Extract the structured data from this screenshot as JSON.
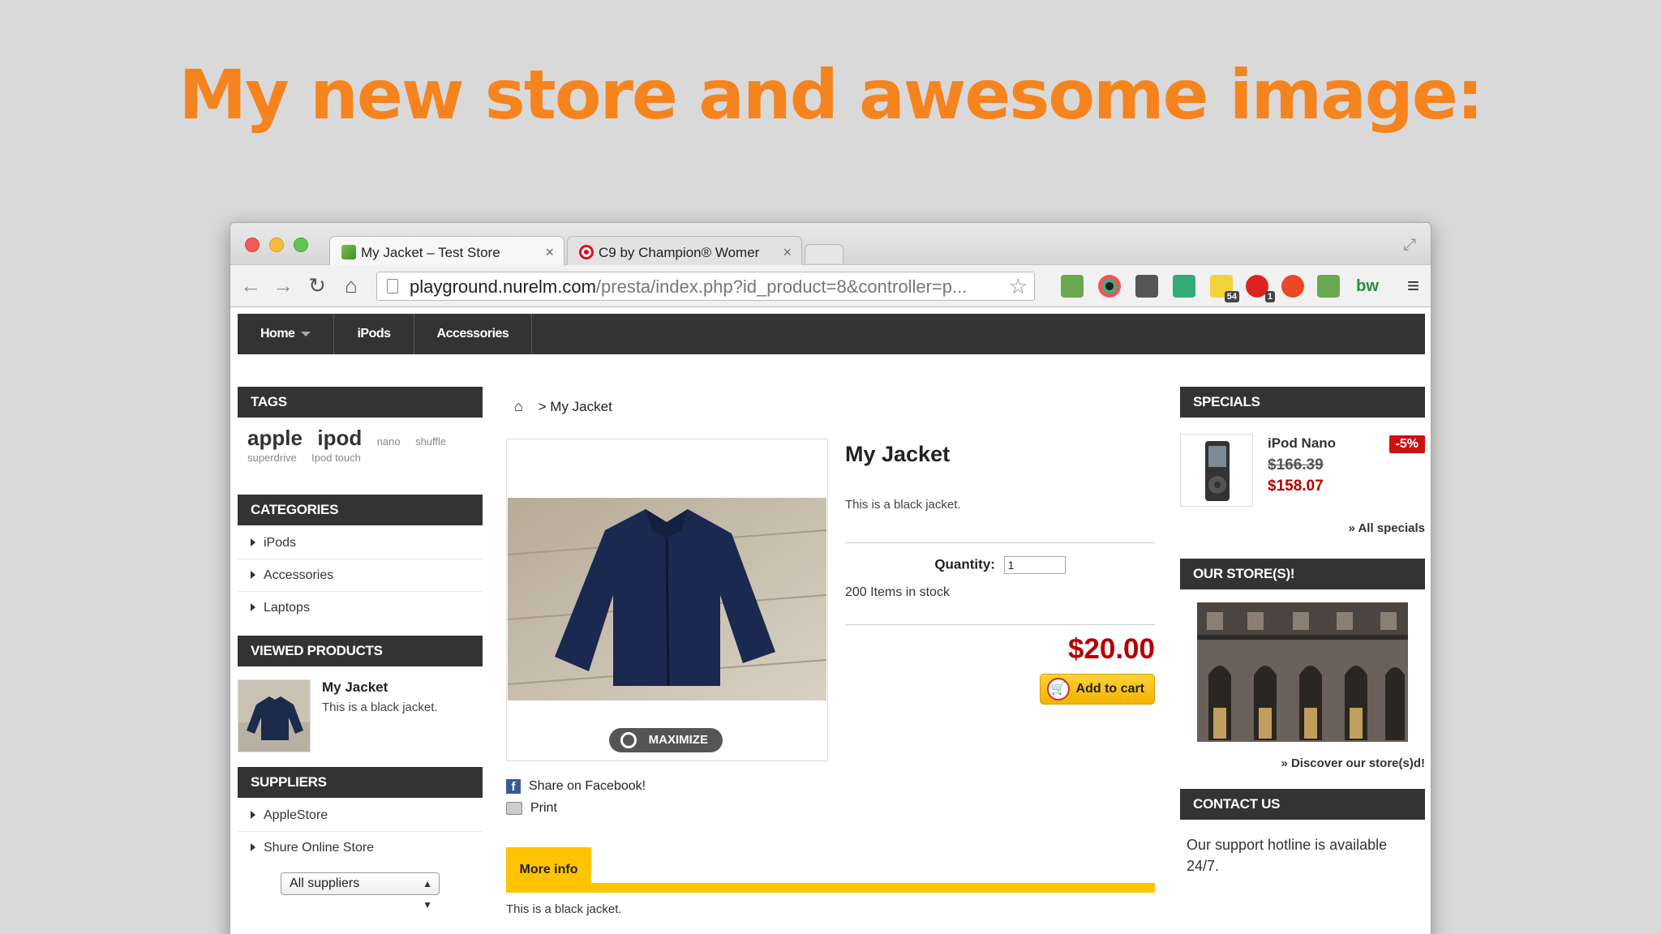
{
  "slide": {
    "title": "My new store and awesome image:"
  },
  "browser": {
    "tabs": [
      {
        "title": "My Jacket – Test Store",
        "close": "×"
      },
      {
        "title": "C9 by Champion® Womer",
        "close": "×"
      }
    ],
    "url_host": "playground.nurelm.com",
    "url_path": "/presta/index.php?id_product=8&controller=p...",
    "extension_badges": [
      "54",
      "1"
    ],
    "ext_bw_label": "bw"
  },
  "store": {
    "top_nav": [
      "Home",
      "iPods",
      "Accessories"
    ],
    "tags": {
      "title": "TAGS",
      "big": [
        "apple",
        "ipod"
      ],
      "small": [
        "nano",
        "shuffle",
        "superdrive",
        "Ipod touch"
      ]
    },
    "categories": {
      "title": "CATEGORIES",
      "items": [
        "iPods",
        "Accessories",
        "Laptops"
      ]
    },
    "viewed": {
      "title": "VIEWED PRODUCTS",
      "name": "My Jacket",
      "desc": "This is a black jacket."
    },
    "suppliers": {
      "title": "SUPPLIERS",
      "items": [
        "AppleStore",
        "Shure Online Store"
      ],
      "select": "All suppliers"
    },
    "breadcrumb": {
      "sep": ">",
      "current": "My Jacket"
    },
    "product": {
      "title": "My Jacket",
      "short_desc": "This is a black jacket.",
      "qty_label": "Quantity:",
      "qty_value": "1",
      "stock": "200 Items in stock",
      "price": "$20.00",
      "add_to_cart": "Add to cart",
      "maximize": "MAXIMIZE",
      "share_fb": "Share on Facebook!",
      "print": "Print",
      "more_info_tab": "More info",
      "more_info_text": "This is a black jacket."
    },
    "specials": {
      "title": "SPECIALS",
      "name": "iPod Nano",
      "old_price": "$166.39",
      "new_price": "$158.07",
      "discount": "-5%",
      "link": "» All specials"
    },
    "stores": {
      "title": "OUR STORE(S)!",
      "link": "» Discover our store(s)d!"
    },
    "contact": {
      "title": "CONTACT US",
      "text": "Our support hotline is available 24/7."
    }
  },
  "colors": {
    "accent": "#f5841f",
    "price_red": "#b30000",
    "nav_dark": "#333333",
    "yellow": "#ffc400"
  }
}
